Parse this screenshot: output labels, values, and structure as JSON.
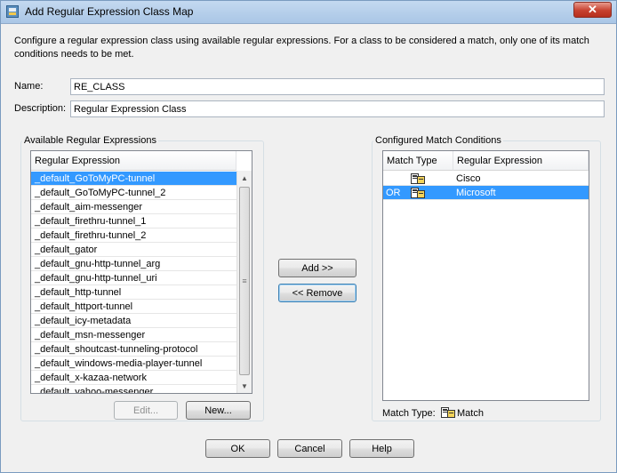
{
  "window": {
    "title": "Add Regular Expression Class Map",
    "close_label": "✕"
  },
  "description": "Configure a regular expression class using available regular expressions. For a class to be considered a match, only one of its match conditions needs to be met.",
  "form": {
    "name_label": "Name:",
    "name_value": "RE_CLASS",
    "description_label": "Description:",
    "description_value": "Regular Expression Class"
  },
  "available": {
    "title": "Available Regular Expressions",
    "column": "Regular Expression",
    "items": [
      "_default_GoToMyPC-tunnel",
      "_default_GoToMyPC-tunnel_2",
      "_default_aim-messenger",
      "_default_firethru-tunnel_1",
      "_default_firethru-tunnel_2",
      "_default_gator",
      "_default_gnu-http-tunnel_arg",
      "_default_gnu-http-tunnel_uri",
      "_default_http-tunnel",
      "_default_httport-tunnel",
      "_default_icy-metadata",
      "_default_msn-messenger",
      "_default_shoutcast-tunneling-protocol",
      "_default_windows-media-player-tunnel",
      "_default_x-kazaa-network",
      "_default_yahoo-messenger"
    ],
    "selected_index": 0,
    "edit_label": "Edit...",
    "new_label": "New..."
  },
  "actions": {
    "add_label": "Add >>",
    "remove_label": "<< Remove"
  },
  "configured": {
    "title": "Configured Match Conditions",
    "col_match_type": "Match Type",
    "col_regex": "Regular Expression",
    "rows": [
      {
        "op": "",
        "icon": "match-icon",
        "regex": "Cisco"
      },
      {
        "op": "OR",
        "icon": "match-icon",
        "regex": "Microsoft"
      }
    ],
    "selected_index": 1,
    "match_type_label": "Match Type:",
    "match_type_value": "Match"
  },
  "footer": {
    "ok_label": "OK",
    "cancel_label": "Cancel",
    "help_label": "Help"
  },
  "colors": {
    "selection": "#3399ff",
    "close_button": "#c7412f"
  }
}
